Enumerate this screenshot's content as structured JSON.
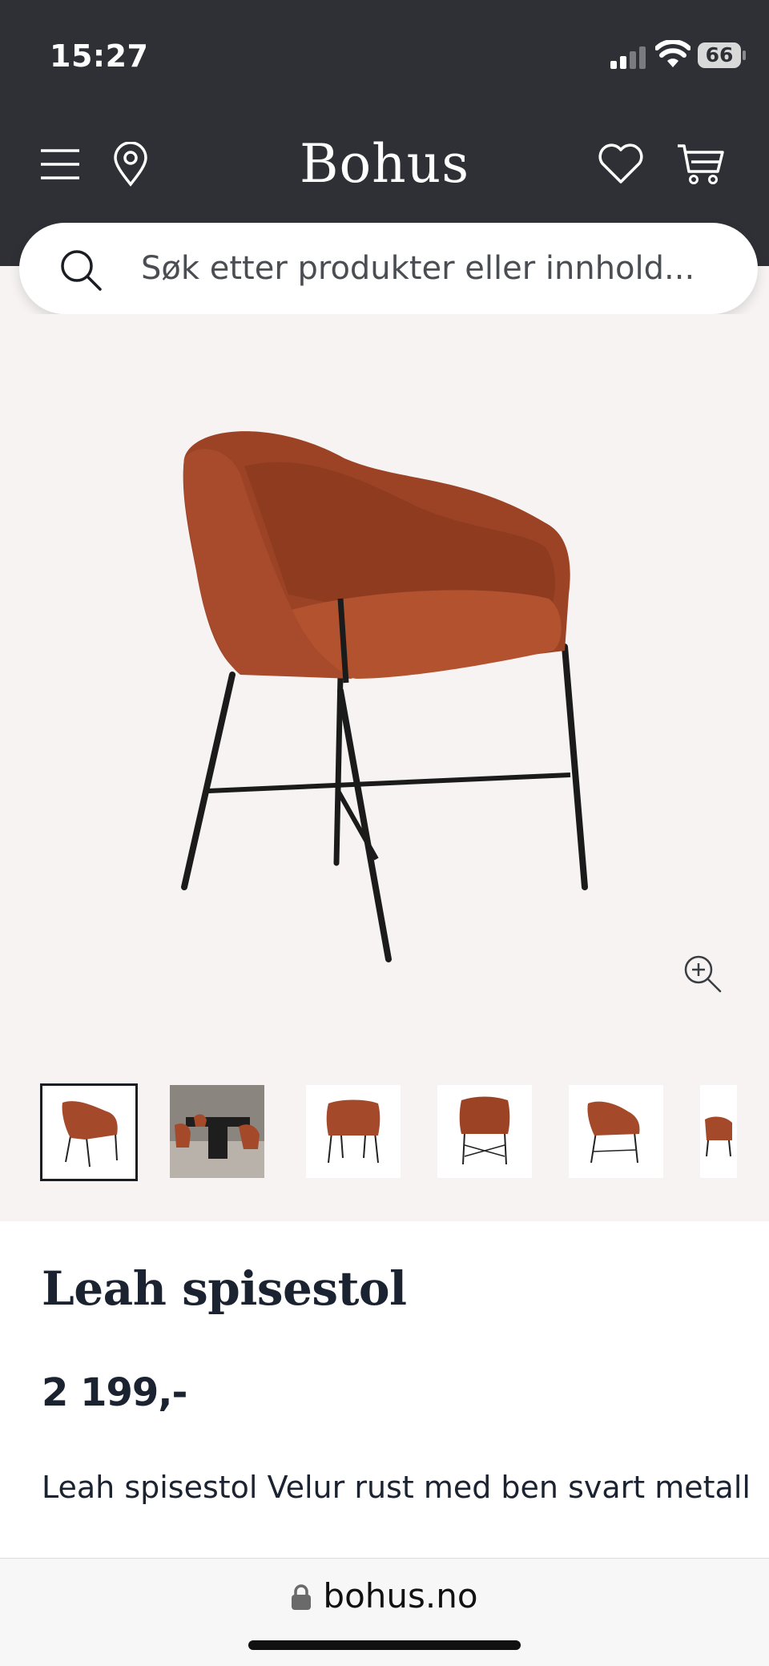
{
  "status_bar": {
    "time": "15:27",
    "battery": "66"
  },
  "header": {
    "logo": "Bohus",
    "icons": {
      "menu": "menu-icon",
      "location": "location-pin-icon",
      "wishlist": "heart-icon",
      "cart": "cart-icon"
    }
  },
  "search": {
    "placeholder": "Søk etter produkter eller innhold..."
  },
  "gallery": {
    "thumbnails": [
      {
        "name": "chair-front-angle",
        "active": true
      },
      {
        "name": "dining-room-scene",
        "active": false
      },
      {
        "name": "chair-front",
        "active": false
      },
      {
        "name": "chair-back",
        "active": false
      },
      {
        "name": "chair-side",
        "active": false
      },
      {
        "name": "chair-partial",
        "active": false
      }
    ]
  },
  "product": {
    "title": "Leah spisestol",
    "price": "2 199,-",
    "description": "Leah spisestol Velur rust med ben svart metall"
  },
  "browser": {
    "url": "bohus.no"
  },
  "colors": {
    "header_bg": "#2f3035",
    "chair": "#a4492a",
    "gallery_bg": "#f6f3f2",
    "text": "#1b2230"
  }
}
